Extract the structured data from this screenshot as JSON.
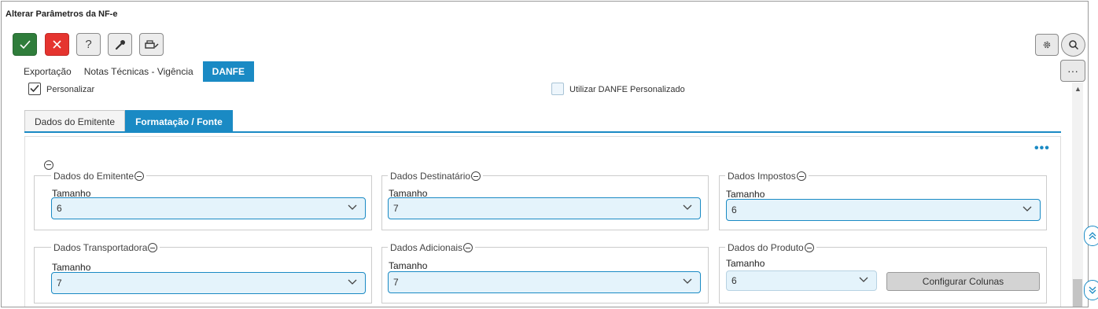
{
  "window": {
    "title": "Alterar Parâmetros da NF-e"
  },
  "toolbar": {
    "confirm_icon": "check-icon",
    "cancel_icon": "close-icon",
    "help_label": "?",
    "tool_icon": "wrench-icon",
    "print_icon": "printer-icon"
  },
  "tabs": [
    {
      "label": "Exportação",
      "active": false
    },
    {
      "label": "Notas Técnicas - Vigência",
      "active": false
    },
    {
      "label": "DANFE",
      "active": true
    }
  ],
  "options": {
    "personalizar": {
      "label": "Personalizar",
      "checked": true
    },
    "utilizar_danfe": {
      "label": "Utilizar DANFE Personalizado",
      "checked": false
    }
  },
  "subtabs": [
    {
      "label": "Dados do Emitente",
      "active": false
    },
    {
      "label": "Formatação / Fonte",
      "active": true
    }
  ],
  "sections": {
    "emitente": {
      "title": "Dados do Emitente",
      "field_label": "Tamanho",
      "value": "6"
    },
    "destinatario": {
      "title": "Dados Destinatário",
      "field_label": "Tamanho",
      "value": "7"
    },
    "impostos": {
      "title": "Dados Impostos",
      "field_label": "Tamanho",
      "value": "6"
    },
    "transportadora": {
      "title": "Dados Transportadora",
      "field_label": "Tamanho",
      "value": "7"
    },
    "adicionais": {
      "title": "Dados Adicionais",
      "field_label": "Tamanho",
      "value": "7"
    },
    "produto": {
      "title": "Dados do Produto",
      "field_label": "Tamanho",
      "value": "6",
      "button_label": "Configurar Colunas"
    }
  },
  "colors": {
    "accent": "#1a8ac4",
    "confirm": "#2f7d3b",
    "cancel": "#e5342f"
  }
}
